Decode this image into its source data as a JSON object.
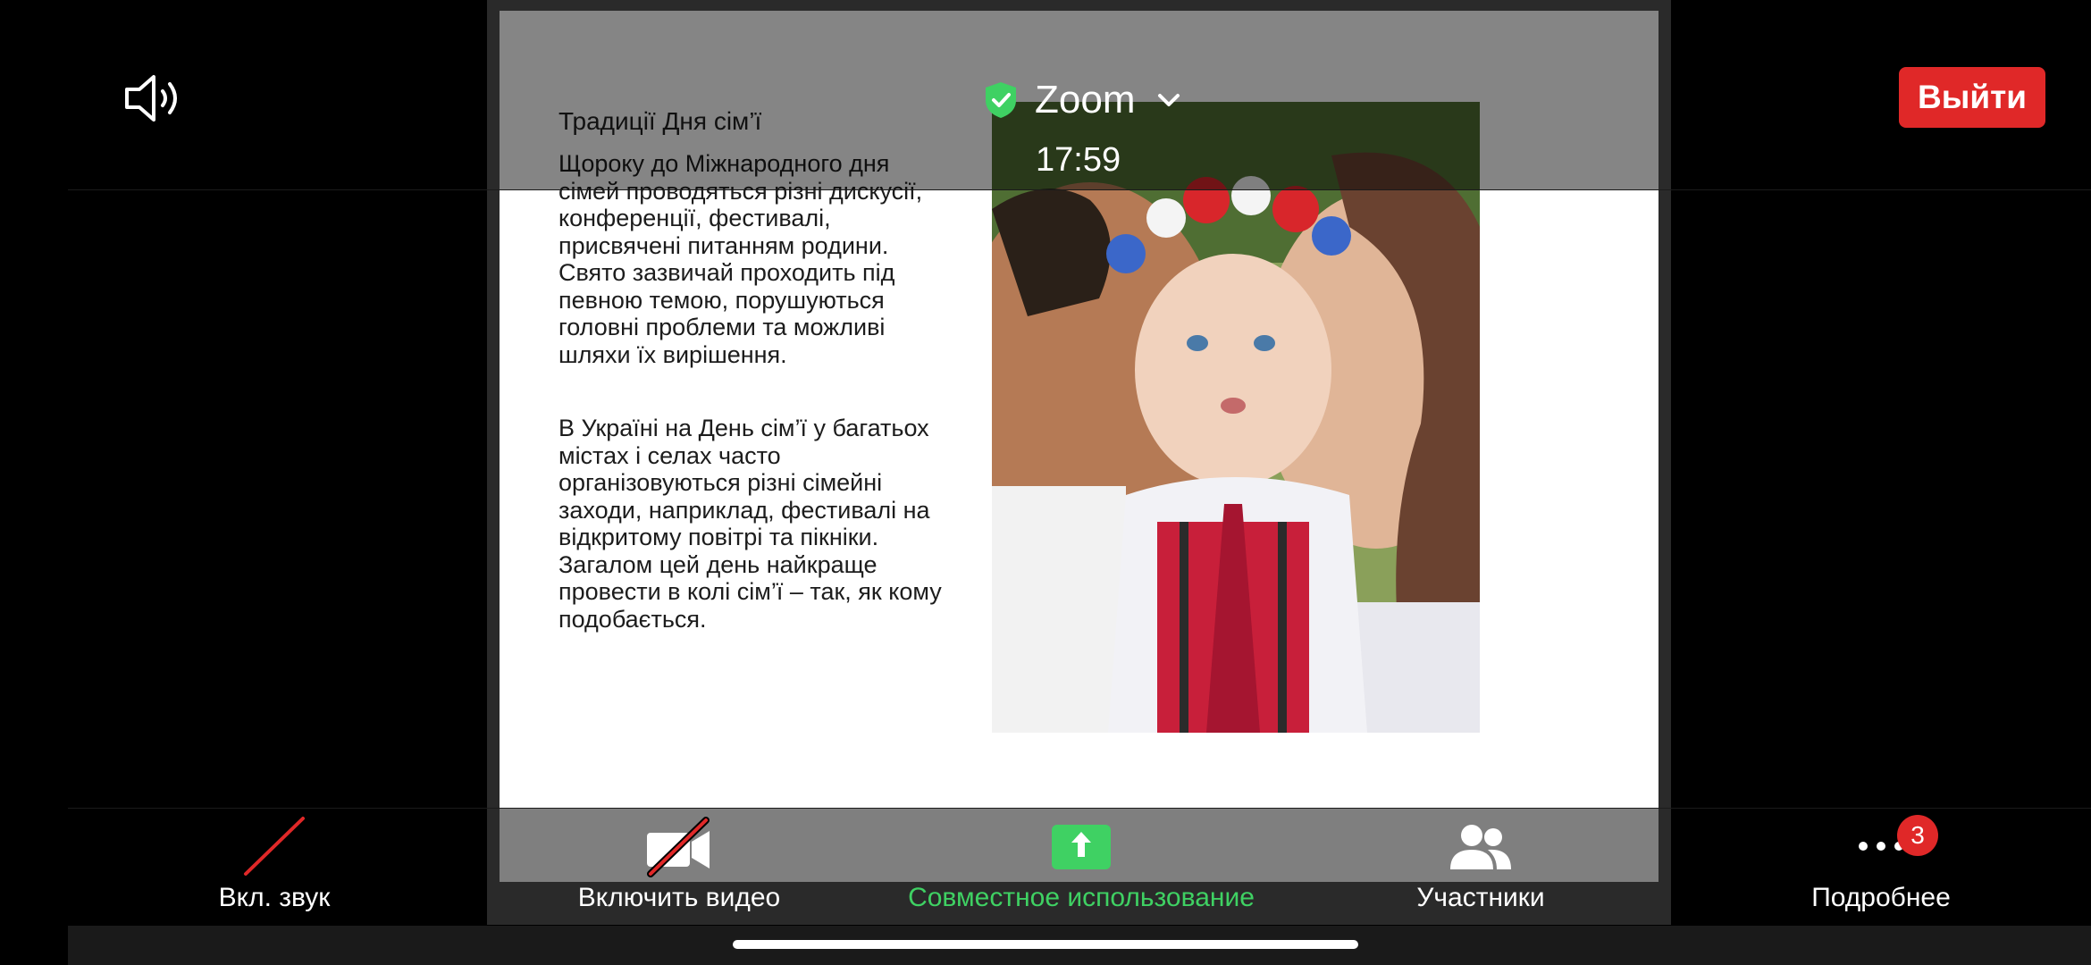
{
  "header": {
    "meeting_name": "Zoom",
    "time": "17:59",
    "leave_label": "Выйти"
  },
  "slide": {
    "title": "Традиції Дня сім’ї",
    "paragraph1": "Щороку до Міжнародного дня сімей проводяться різні дискусії, конференції, фестивалі, присвячені питанням родини. Свято зазвичай проходить під певною темою, порушуються головні проблеми та можливі шляхи їх вирішення.",
    "paragraph2": "В Україні на День сім’ї у багатьох містах і селах часто організовуються різні сімейні заходи, наприклад, фестивалі на відкритому повітрі та пікніки. Загалом цей день найкраще провести в колі сім’ї – так, як кому подобається."
  },
  "toolbar": {
    "audio_label": "Вкл. звук",
    "video_label": "Включить видео",
    "share_label": "Совместное использование",
    "participants_label": "Участники",
    "more_label": "Подробнее",
    "more_badge": "3"
  },
  "colors": {
    "leave": "#e02828",
    "share_green": "#3fd163",
    "badge": "#e02828"
  }
}
